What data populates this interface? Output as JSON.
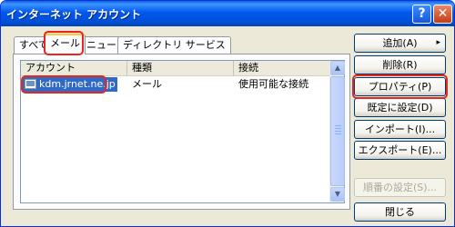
{
  "window": {
    "title": "インターネット アカウント",
    "help_label": "?",
    "close_label": "✕"
  },
  "tabs": [
    {
      "label": "すべて"
    },
    {
      "label": "メール",
      "active": true
    },
    {
      "label": "ニュース"
    },
    {
      "label": "ディレクトリ サービス"
    }
  ],
  "list": {
    "columns": [
      "アカウント",
      "種類",
      "接続"
    ],
    "rows": [
      {
        "account": "kdm.jrnet.ne.jp",
        "type": "メール",
        "connection": "使用可能な接続",
        "selected": true
      }
    ]
  },
  "buttons": {
    "add": "追加(A)",
    "remove": "削除(R)",
    "properties": "プロパティ(P)",
    "set_default": "既定に設定(D)",
    "import": "インポート(I)...",
    "export": "エクスポート(E)...",
    "order": "順番の設定(S)...",
    "close": "閉じる"
  },
  "icons": {
    "add_arrow": "▸",
    "scroll_up": "▲",
    "scroll_down": "▼"
  },
  "colors": {
    "titlebar": "#0058EE",
    "highlight": "#E8251F",
    "selection": "#316AC5"
  }
}
